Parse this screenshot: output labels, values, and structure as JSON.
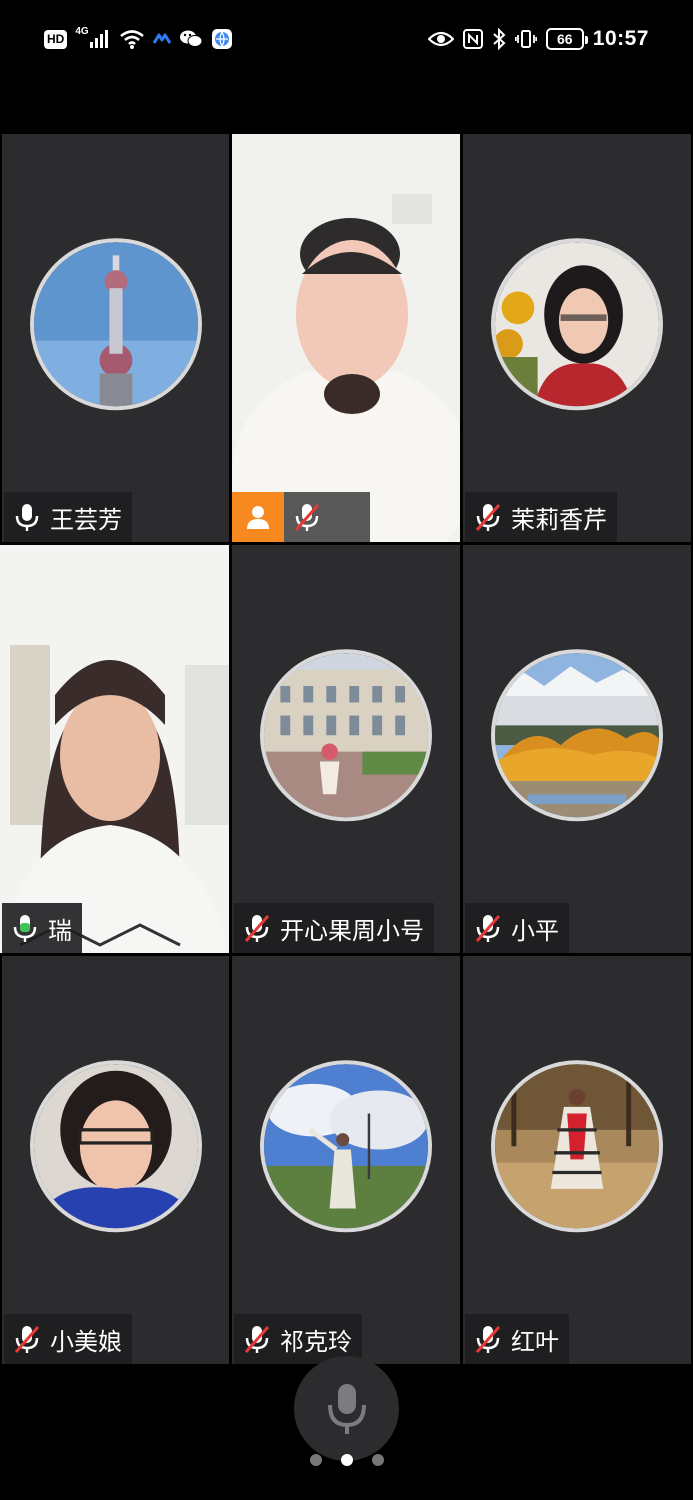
{
  "status_bar": {
    "hd": "HD",
    "network": "4G",
    "time": "10:57",
    "battery": "66"
  },
  "participants": [
    {
      "name": "王芸芳",
      "mic": "on",
      "type": "avatar",
      "avatar": "tower"
    },
    {
      "name": "",
      "mic": "muted",
      "type": "video",
      "host": true,
      "video": "woman-fur"
    },
    {
      "name": "茉莉香芹",
      "mic": "muted",
      "type": "avatar",
      "avatar": "woman-glasses"
    },
    {
      "name": "瑞",
      "mic": "on",
      "type": "video",
      "speaking": true,
      "video": "woman-talking"
    },
    {
      "name": "开心果周小号",
      "mic": "muted",
      "type": "avatar",
      "avatar": "palace"
    },
    {
      "name": "小平",
      "mic": "muted",
      "type": "avatar",
      "avatar": "autumn-lake"
    },
    {
      "name": "小美娘",
      "mic": "muted",
      "type": "avatar",
      "avatar": "woman-portrait"
    },
    {
      "name": "祁克玲",
      "mic": "muted",
      "type": "avatar",
      "avatar": "woman-sky"
    },
    {
      "name": "红叶",
      "mic": "muted",
      "type": "avatar",
      "avatar": "woman-forest"
    }
  ],
  "colors": {
    "tile_bg": "#2c2c2e",
    "mic_on": "#3ec45a",
    "mic_muted": "#e53935",
    "host_badge": "#f6891f",
    "active_border": "#3ec45a"
  },
  "pager": {
    "count": 3,
    "active": 1
  }
}
